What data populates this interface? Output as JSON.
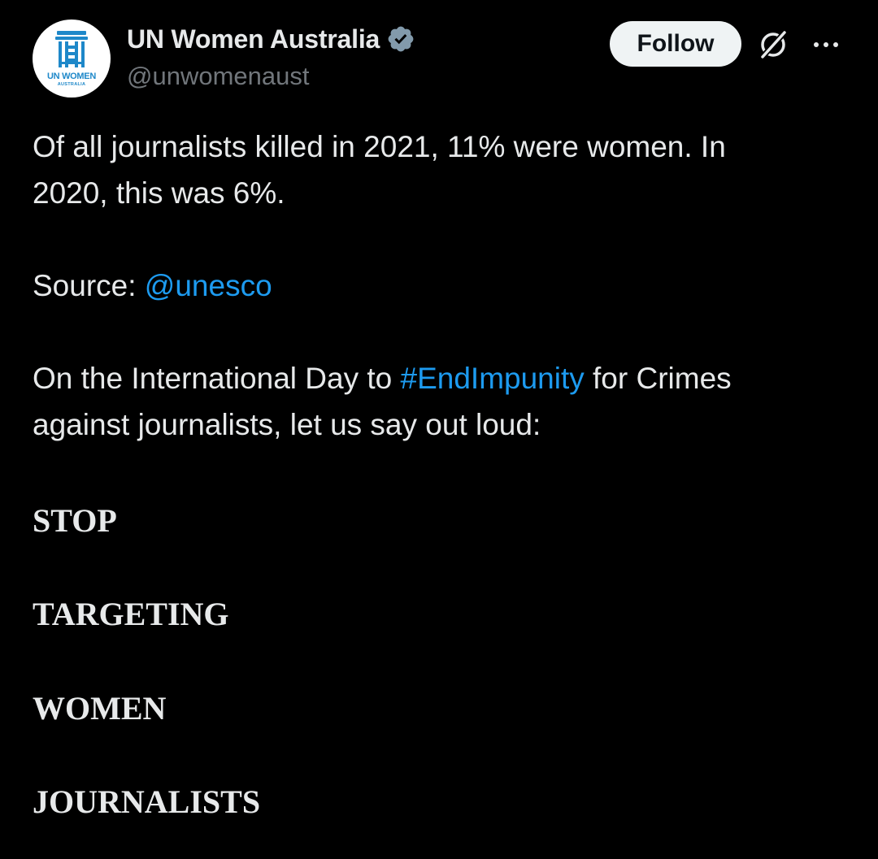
{
  "author": {
    "display_name": "UN Women Australia",
    "handle": "@unwomenaust",
    "verified_icon": "verified-badge-icon",
    "avatar": {
      "line1": "UN WOMEN",
      "line2": "AUSTRALIA",
      "brand_color": "#1e88c9"
    }
  },
  "actions": {
    "follow_label": "Follow",
    "grok_icon": "grok-icon",
    "more_icon": "more-icon"
  },
  "tweet": {
    "line1": "Of all journalists killed in 2021, 11% were women. In",
    "line2": "2020, this was 6%.",
    "source_prefix": "Source: ",
    "source_mention": "@unesco",
    "p3_before": "On the International Day to ",
    "p3_hashtag": "#EndImpunity",
    "p3_after": " for Crimes",
    "p3_line2": "against journalists, let us say out loud:",
    "shout": [
      "STOP",
      "TARGETING",
      "WOMEN",
      "JOURNALISTS"
    ]
  },
  "colors": {
    "background": "#000000",
    "text": "#e7e9ea",
    "secondary_text": "#71767b",
    "link": "#1d9bf0",
    "verified_badge": "#829aab"
  }
}
